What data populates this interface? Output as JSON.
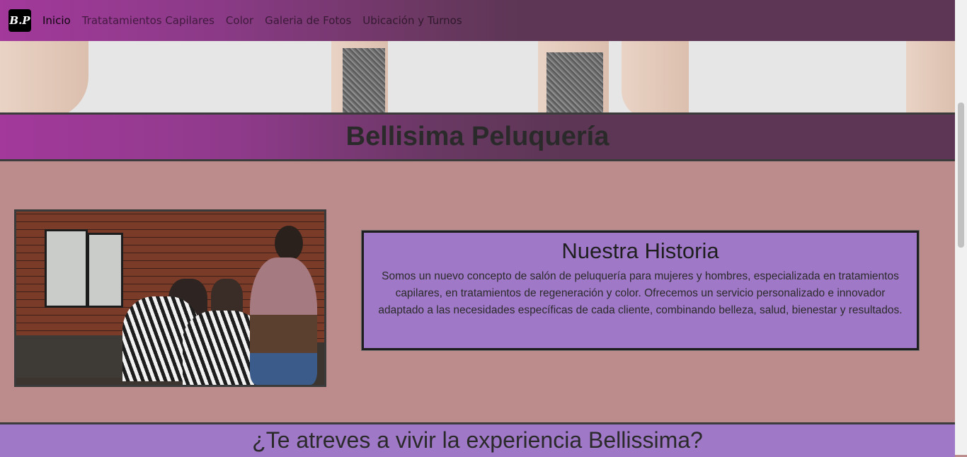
{
  "navbar": {
    "logo_text": "B.P",
    "links": [
      {
        "label": "Inicio",
        "active": true
      },
      {
        "label": "Tratatamientos Capilares",
        "active": false
      },
      {
        "label": "Color",
        "active": false
      },
      {
        "label": "Galeria de Fotos",
        "active": false
      },
      {
        "label": "Ubicación y Turnos",
        "active": false
      }
    ]
  },
  "header": {
    "title": "Bellisima Peluquería"
  },
  "story": {
    "heading": "Nuestra Historia",
    "body": "Somos un nuevo concepto de salón de peluquería para mujeres y hombres, especializada en tratamientos capilares, en tratamientos de regeneración y color. Ofrecemos un servicio personalizado e innovador adaptado a las necesidades específicas de cada cliente, combinando belleza, salud, bienestar y resultados."
  },
  "cta": {
    "heading": "¿Te atreves a vivir la experiencia Bellissima?"
  },
  "colors": {
    "nav_gradient_start": "#a2399b",
    "nav_gradient_end": "#5c3654",
    "page_background": "#bc8c8c",
    "story_box": "#a078c8"
  }
}
